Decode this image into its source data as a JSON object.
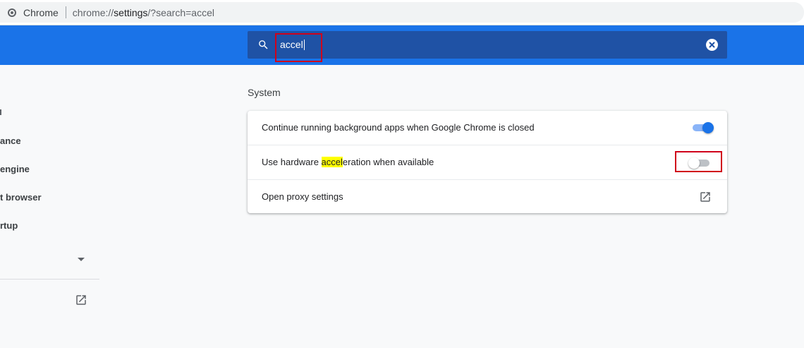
{
  "browser": {
    "site_name": "Chrome",
    "url_scheme": "chrome://",
    "url_host": "settings",
    "url_path": "/?search=accel"
  },
  "search": {
    "value": "accel",
    "icon": "search-icon",
    "clear_icon": "clear-icon"
  },
  "sidebar": {
    "items": [
      {
        "label": "ance"
      },
      {
        "label": " engine"
      },
      {
        "label": "t browser"
      },
      {
        "label": "rtup"
      }
    ],
    "advanced_expand_icon": "caret-down-icon",
    "extensions_icon": "open-in-new-icon"
  },
  "main": {
    "section_title": "System",
    "rows": [
      {
        "label": "Continue running background apps when Google Chrome is closed",
        "toggle_on": true
      },
      {
        "label_before": "Use hardware ",
        "label_highlight": "accel",
        "label_after": "eration when available",
        "toggle_on": false
      },
      {
        "label": "Open proxy settings",
        "icon": "open-in-new-icon"
      }
    ]
  },
  "colors": {
    "header_blue": "#1a73e8",
    "search_bg": "#1f52a5",
    "annotation_red": "#d0021b",
    "highlight_yellow": "#ffff00"
  }
}
